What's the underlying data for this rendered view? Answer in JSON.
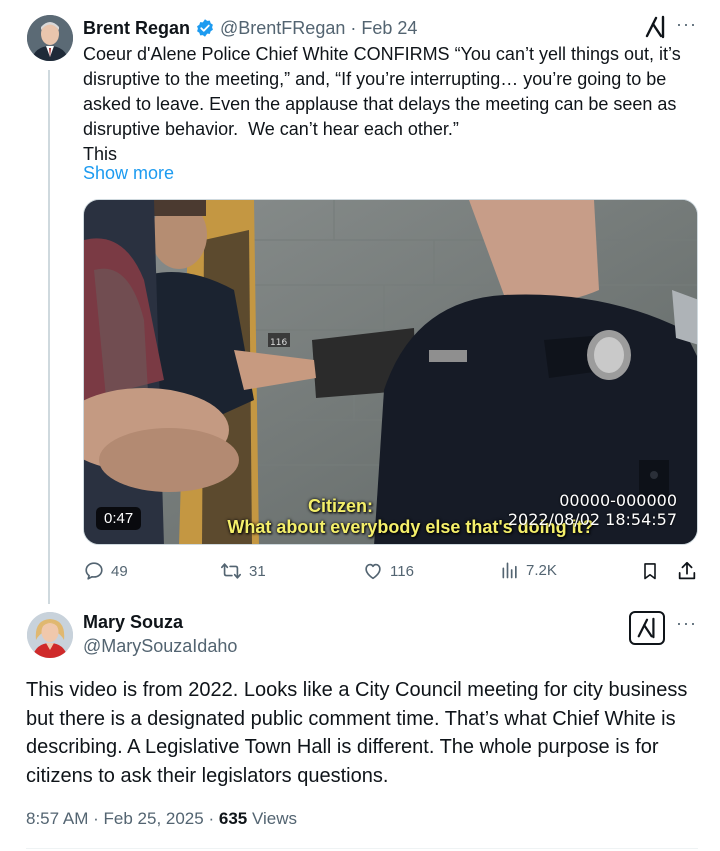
{
  "tweet": {
    "author_name": "Brent Regan",
    "author_handle": "@BrentFRegan",
    "separator": "·",
    "date": "Feb 24",
    "text": "Coeur d'Alene Police Chief White CONFIRMS “You can’t yell things out, it’s\ndisruptive to the meeting,” and, “If you’re interrupting… you’re going to be\nasked to leave. Even the applause that delays the meeting can be seen as\ndisruptive behavior.  We can’t hear each other.”\nThis",
    "show_more_label": "Show more",
    "more_label": "···",
    "video": {
      "duration": "0:47",
      "caption_speaker": "Citizen:",
      "caption_line": "What about everybody else that's doing it?",
      "camera_id": "00000-000000",
      "camera_datetime": "2022/08/02 18:54:57",
      "door_number": "116"
    },
    "actions": {
      "replies": "49",
      "reposts": "31",
      "likes": "116",
      "views": "7.2K"
    }
  },
  "reply": {
    "author_name": "Mary Souza",
    "author_handle": "@MarySouzaIdaho",
    "more_label": "···",
    "text": "This video is from 2022. Looks like a City Council meeting for city business but there is a designated public comment time. That’s what Chief White is describing. A Legislative Town Hall is different. The whole purpose is for citizens to ask their legislators questions.",
    "time": "8:57 AM",
    "separator": "·",
    "date": "Feb 25, 2025",
    "views_count": "635",
    "views_label": "Views"
  },
  "colors": {
    "accent": "#1d9bf0",
    "secondary_text": "#536471",
    "primary_text": "#0f1419",
    "caption": "#f4ef6a",
    "divider": "#cfd9de"
  },
  "icons": [
    "verified-badge-icon",
    "grok-icon",
    "more-icon",
    "reply-icon",
    "repost-icon",
    "like-icon",
    "views-icon",
    "bookmark-icon",
    "share-icon"
  ]
}
